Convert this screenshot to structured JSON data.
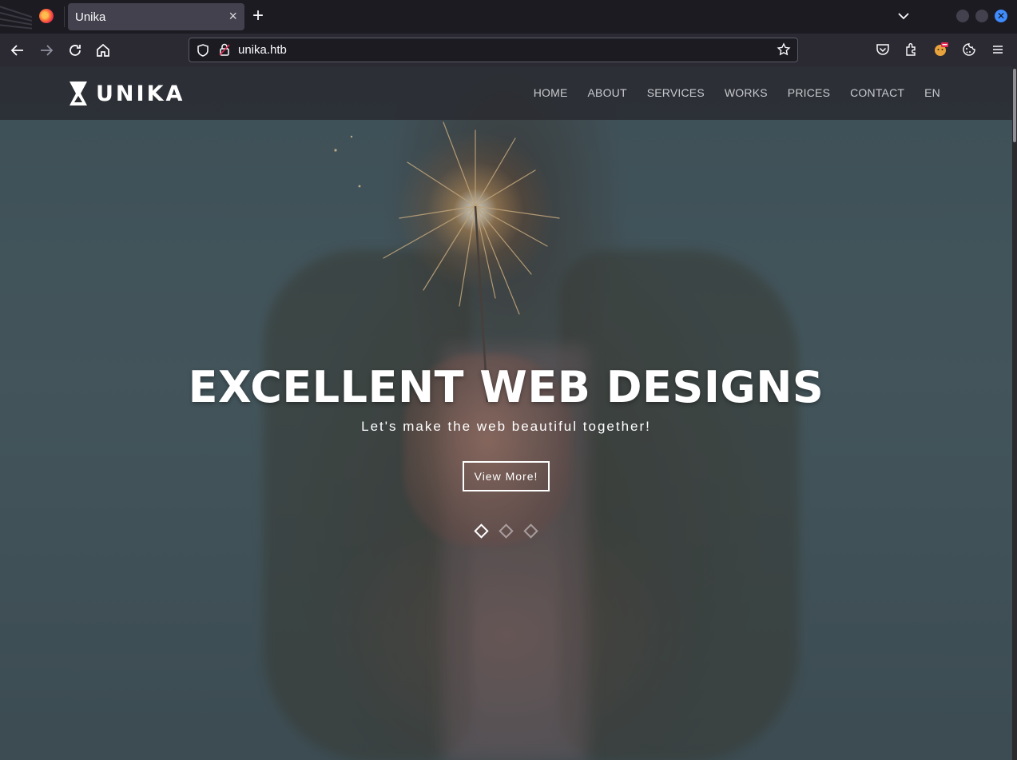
{
  "browser": {
    "tab": {
      "title": "Unika",
      "close_glyph": "×"
    },
    "new_tab_glyph": "+",
    "address": {
      "url": "unika.htb"
    },
    "icons": [
      "firefox-logo-icon",
      "back-icon",
      "forward-icon",
      "reload-icon",
      "home-icon",
      "shield-icon",
      "lock-icon",
      "star-icon",
      "pocket-icon",
      "extensions-icon",
      "profile-extension-icon",
      "cookie-icon",
      "menu-icon"
    ],
    "colors": {
      "window_close": "#3f8cff",
      "chrome_bg": "#1c1b22",
      "toolbar_bg": "#2b2a33"
    }
  },
  "site": {
    "logo_text": "UNIKA",
    "nav": [
      {
        "label": "HOME"
      },
      {
        "label": "ABOUT"
      },
      {
        "label": "SERVICES"
      },
      {
        "label": "WORKS"
      },
      {
        "label": "PRICES"
      },
      {
        "label": "CONTACT"
      },
      {
        "label": "EN"
      }
    ],
    "hero": {
      "title": "EXCELLENT WEB DESIGNS",
      "subtitle": "Let's make the web beautiful together!",
      "button_label": "View More!",
      "slides_total": 3,
      "active_slide": 1
    }
  }
}
